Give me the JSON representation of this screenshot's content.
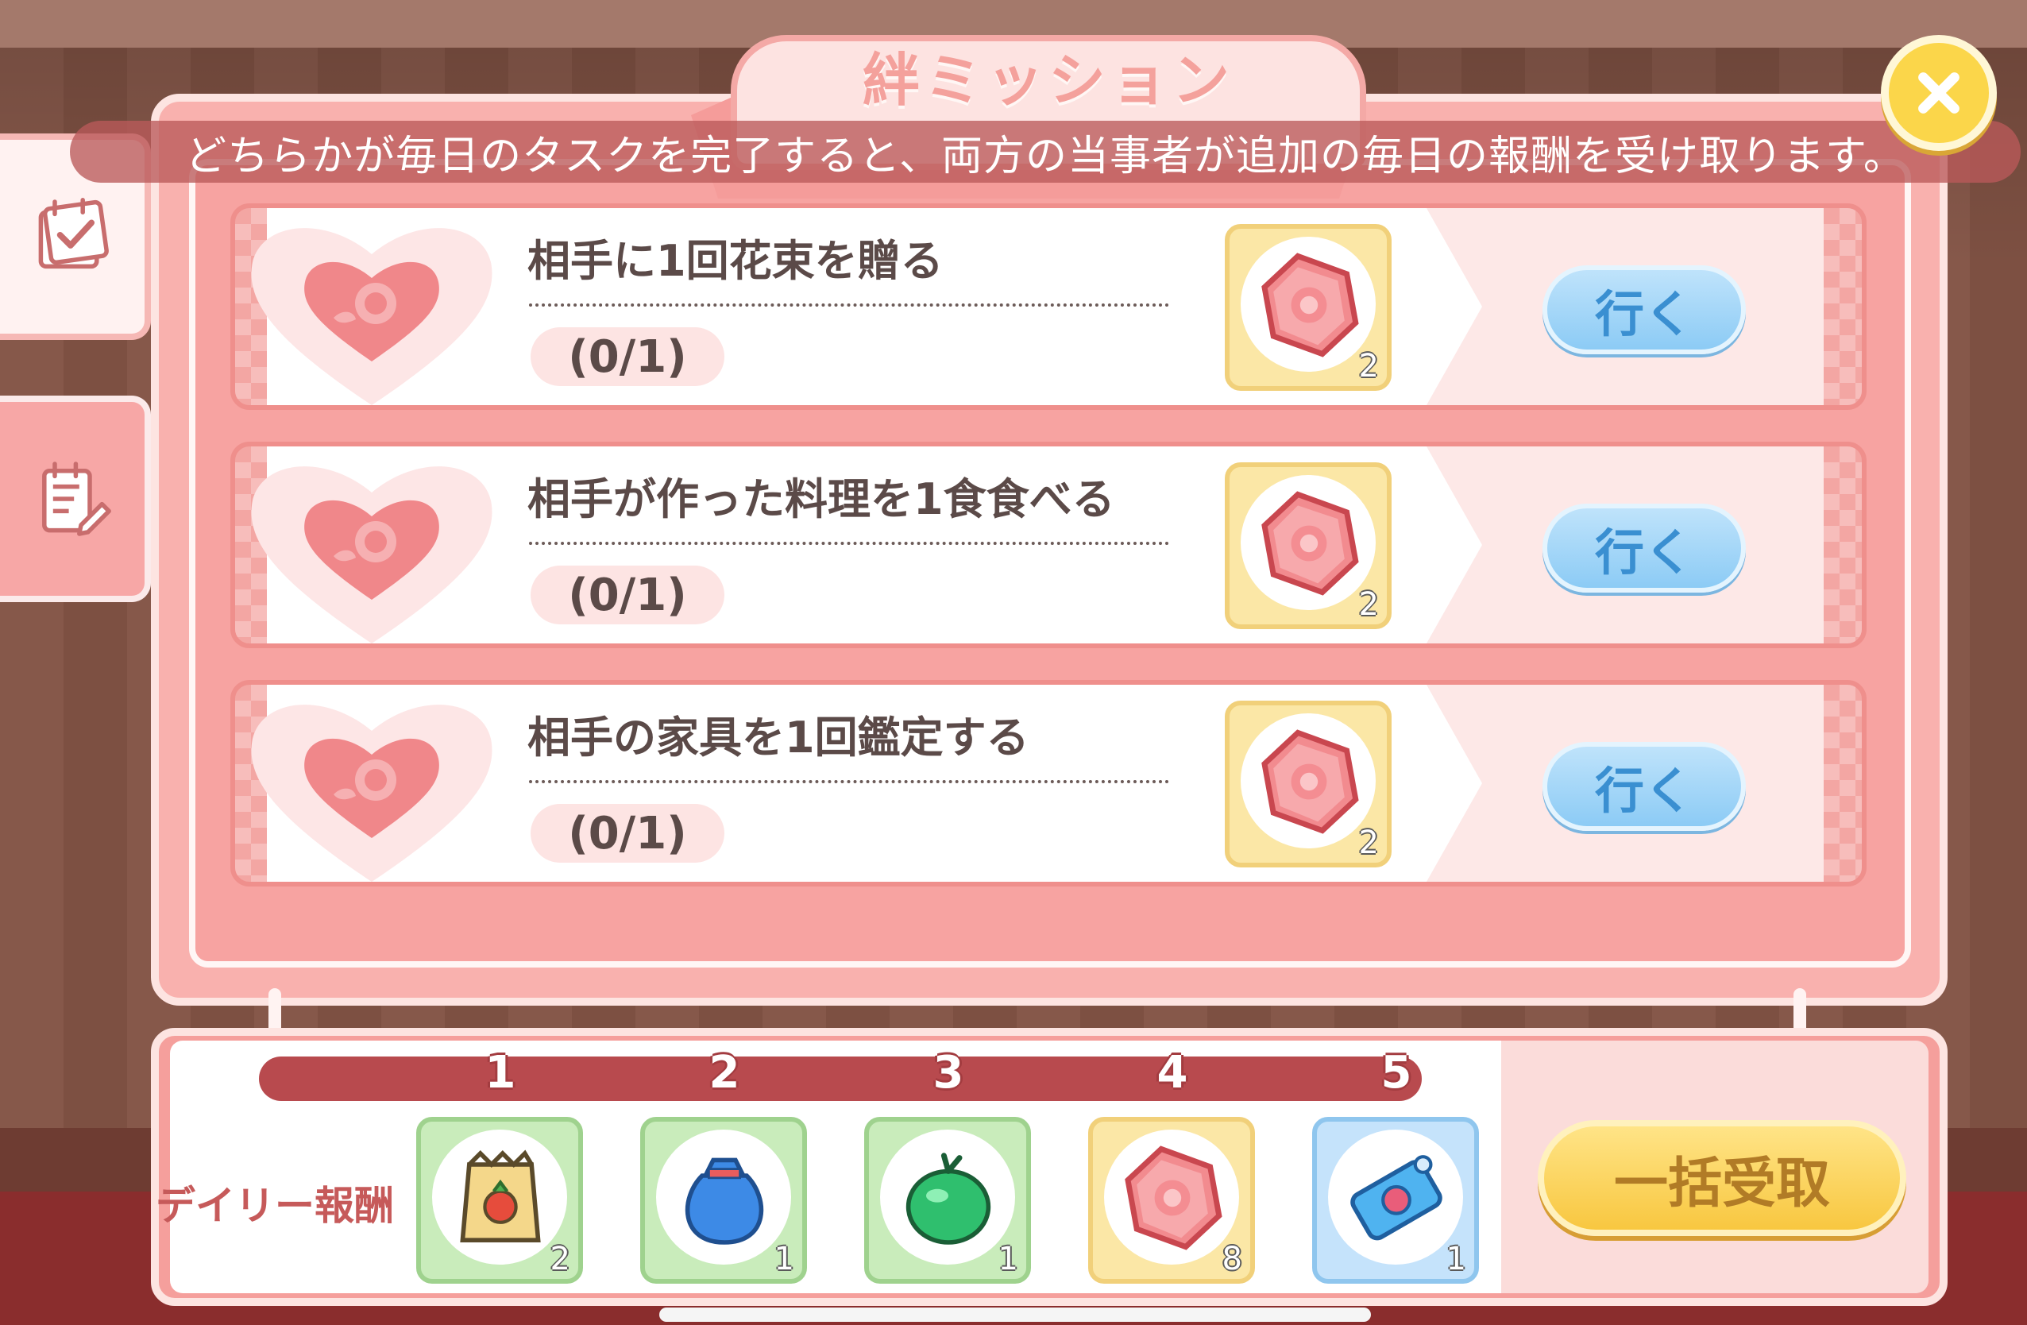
{
  "header": {
    "title": "絆ミッション",
    "description": "どちらかが毎日のタスクを完了すると、両方の当事者が追加の毎日の報酬を受け取ります。"
  },
  "side_tabs": [
    {
      "icon": "calendar-check-icon",
      "active": true
    },
    {
      "icon": "notepad-edit-icon",
      "active": false
    }
  ],
  "missions": [
    {
      "title": "相手に1回花束を贈る",
      "progress": "(0/1)",
      "reward_icon": "rose-gem-icon",
      "reward_qty": "2",
      "go_label": "行く"
    },
    {
      "title": "相手が作った料理を1食食べる",
      "progress": "(0/1)",
      "reward_icon": "rose-gem-icon",
      "reward_qty": "2",
      "go_label": "行く"
    },
    {
      "title": "相手の家具を1回鑑定する",
      "progress": "(0/1)",
      "reward_icon": "rose-gem-icon",
      "reward_qty": "2",
      "go_label": "行く"
    }
  ],
  "daily_rewards": {
    "label": "デイリー報酬",
    "milestones": [
      "1",
      "2",
      "3",
      "4",
      "5"
    ],
    "progress": 0,
    "items": [
      {
        "icon": "seed-bag-icon",
        "qty": "2"
      },
      {
        "icon": "blue-sack-icon",
        "qty": "1"
      },
      {
        "icon": "green-fruit-icon",
        "qty": "1"
      },
      {
        "icon": "rose-gem-icon",
        "qty": "8"
      },
      {
        "icon": "blue-ticket-icon",
        "qty": "1"
      }
    ],
    "claim_all_label": "一括受取"
  },
  "colors": {
    "panel": "#f9b1ae",
    "accent_red": "#b84a4e",
    "go_button": "#8ccbf5",
    "claim_button": "#f8c740",
    "close_button": "#fbd64a"
  }
}
